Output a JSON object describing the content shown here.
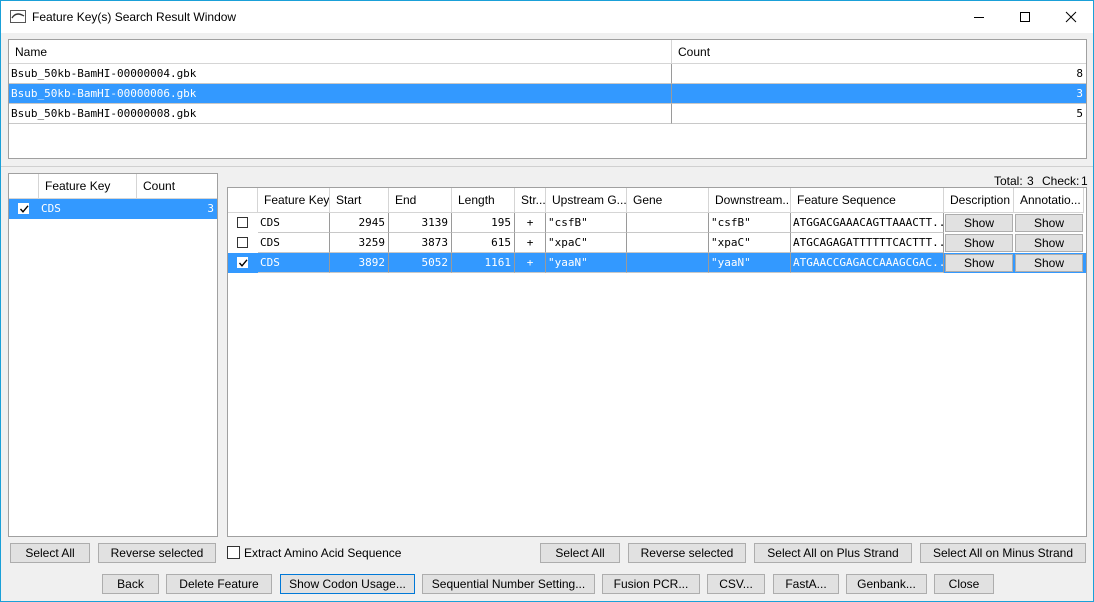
{
  "window": {
    "title": "Feature Key(s) Search Result Window"
  },
  "files_table": {
    "headers": {
      "name": "Name",
      "count": "Count"
    },
    "rows": [
      {
        "name": "Bsub_50kb-BamHI-00000004.gbk",
        "count": "8",
        "selected": false
      },
      {
        "name": "Bsub_50kb-BamHI-00000006.gbk",
        "count": "3",
        "selected": true
      },
      {
        "name": "Bsub_50kb-BamHI-00000008.gbk",
        "count": "5",
        "selected": false
      }
    ]
  },
  "key_table": {
    "headers": {
      "key": "Feature Key",
      "count": "Count"
    },
    "rows": [
      {
        "key": "CDS",
        "count": "3",
        "checked": true,
        "selected": true
      }
    ]
  },
  "status": {
    "total_label": "Total:",
    "total_value": "3",
    "check_label": "Check:",
    "check_value": "1"
  },
  "feature_table": {
    "headers": {
      "key": "Feature Key",
      "start": "Start",
      "end": "End",
      "length": "Length",
      "strand": "Str...",
      "upstream": "Upstream G...",
      "gene": "Gene",
      "downstream": "Downstream...",
      "sequence": "Feature Sequence",
      "description": "Description",
      "annotation": "Annotatio..."
    },
    "show_label": "Show",
    "rows": [
      {
        "checked": false,
        "selected": false,
        "key": "CDS",
        "start": "2945",
        "end": "3139",
        "length": "195",
        "strand": "+",
        "upstream": "\"csfB\"",
        "gene": "",
        "downstream": "\"csfB\"",
        "sequence": "ATGGACGAAACAGTTAAACTT..."
      },
      {
        "checked": false,
        "selected": false,
        "key": "CDS",
        "start": "3259",
        "end": "3873",
        "length": "615",
        "strand": "+",
        "upstream": "\"xpaC\"",
        "gene": "",
        "downstream": "\"xpaC\"",
        "sequence": "ATGCAGAGATTTTTTCACTTT..."
      },
      {
        "checked": true,
        "selected": true,
        "key": "CDS",
        "start": "3892",
        "end": "5052",
        "length": "1161",
        "strand": "+",
        "upstream": "\"yaaN\"",
        "gene": "",
        "downstream": "\"yaaN\"",
        "sequence": "ATGAACCGAGACCAAAGCGAC..."
      }
    ]
  },
  "left_buttons": {
    "select_all": "Select All",
    "reverse": "Reverse selected"
  },
  "extract_label": "Extract Amino Acid Sequence",
  "right_buttons": {
    "select_all": "Select All",
    "reverse": "Reverse selected",
    "plus": "Select All on Plus Strand",
    "minus": "Select All on Minus Strand"
  },
  "bottom_buttons": {
    "back": "Back",
    "delete": "Delete Feature",
    "codon": "Show Codon Usage...",
    "sequential": "Sequential Number Setting...",
    "fusion": "Fusion PCR...",
    "csv": "CSV...",
    "fasta": "FastA...",
    "genbank": "Genbank...",
    "close": "Close"
  },
  "colors": {
    "selection": "#3399ff",
    "window_border": "#1aa0d8"
  },
  "icons": [
    "app-icon",
    "minimize-icon",
    "maximize-icon",
    "close-icon",
    "checkmark-icon"
  ]
}
